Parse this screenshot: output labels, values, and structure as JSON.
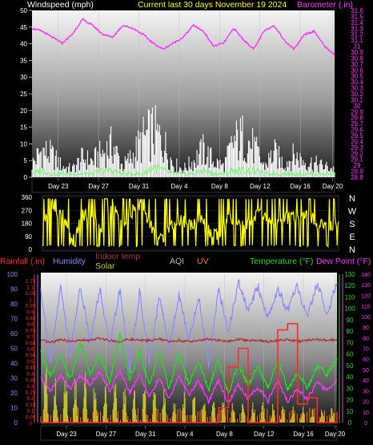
{
  "colors": {
    "wind": "#ffffff",
    "gust": "#66ff66",
    "baro": "#ff33ff",
    "dir": "#ffff00",
    "rain": "#ff2a2a",
    "humidity": "#8a8cff",
    "indoor": "#b0313d",
    "solar": "#cfcf2f",
    "aqi": "#bbbbbb",
    "uv": "#ff7a1a",
    "temp": "#22dd22",
    "dew": "#ff33ff",
    "frame": "#111111"
  },
  "header": {
    "windspeed_label": "Windspeed (mph)",
    "center_title": "Current last 30 days November 19 2024",
    "barometer_label": "Barometer (.in)"
  },
  "direction_labels": [
    "N",
    "W",
    "S",
    "E",
    "N"
  ],
  "bottom_header": {
    "rainfall": "Rainfall (.in)",
    "humidity": "Humidity",
    "indoor_temp": "Indoor temp",
    "solar": "Solar",
    "aqi": "AQI",
    "uv": "UV",
    "temperature": "Temperature (°F)",
    "dew_point": "Dew Point (°F)"
  },
  "chart_data": [
    {
      "type": "line",
      "name": "wind-barometer",
      "x_ticks": [
        "Day 23",
        "Day 27",
        "Day 31",
        "Day 4",
        "Day 8",
        "Day 12",
        "Day 16",
        "Day 20"
      ],
      "left_axis": {
        "label": "Windspeed (mph)",
        "range": [
          0,
          50
        ],
        "ticks": [
          "0",
          "5",
          "10",
          "15",
          "20",
          "25",
          "30",
          "35",
          "40",
          "45",
          "50"
        ]
      },
      "right_axis": {
        "label": "Barometer (.in)",
        "range": [
          28.8,
          31.6
        ],
        "ticks": [
          "28.8",
          "28.9",
          "29",
          "29.1",
          "29.2",
          "29.3",
          "29.4",
          "29.5",
          "29.6",
          "29.7",
          "29.8",
          "29.9",
          "30",
          "30.1",
          "30.2",
          "30.3",
          "30.4",
          "30.5",
          "30.6",
          "30.7",
          "30.8",
          "30.9",
          "31",
          "31.1",
          "31.2",
          "31.3",
          "31.4",
          "31.5",
          "31.6"
        ]
      },
      "series": [
        {
          "name": "Barometer",
          "axis": "right",
          "x": [
            0,
            1,
            2,
            3,
            4,
            5,
            6,
            7,
            8,
            9,
            10,
            11,
            12,
            13,
            14,
            15,
            16,
            17,
            18,
            19,
            20,
            21,
            22,
            23,
            24,
            25,
            26,
            27,
            28,
            29,
            30
          ],
          "values": [
            31.3,
            31.25,
            31.15,
            31.05,
            31.2,
            31.45,
            31.35,
            31.2,
            31.15,
            31.35,
            31.3,
            31.2,
            31.05,
            30.95,
            31.05,
            31.15,
            31.35,
            31.25,
            31.0,
            31.05,
            31.3,
            31.1,
            30.95,
            31.25,
            31.35,
            31.1,
            30.95,
            31.2,
            31.25,
            31.0,
            30.85
          ]
        },
        {
          "name": "Windspeed",
          "axis": "left",
          "x": [
            0,
            1,
            2,
            3,
            4,
            5,
            6,
            7,
            8,
            9,
            10,
            11,
            12,
            13,
            14,
            15,
            16,
            17,
            18,
            19,
            20,
            21,
            22,
            23,
            24,
            25,
            26,
            27,
            28,
            29,
            30
          ],
          "values": [
            5,
            10,
            8,
            4,
            3,
            7,
            6,
            9,
            12,
            4,
            8,
            14,
            17,
            13,
            5,
            3,
            6,
            10,
            6,
            4,
            13,
            15,
            11,
            4,
            9,
            5,
            8,
            6,
            5,
            4,
            3
          ]
        },
        {
          "name": "Gust",
          "axis": "left",
          "x": [
            0,
            1,
            2,
            3,
            4,
            5,
            6,
            7,
            8,
            9,
            10,
            11,
            12,
            13,
            14,
            15,
            16,
            17,
            18,
            19,
            20,
            21,
            22,
            23,
            24,
            25,
            26,
            27,
            28,
            29,
            30
          ],
          "values": [
            1,
            2,
            1,
            1,
            1,
            1,
            1,
            2,
            2,
            1,
            1,
            1,
            3,
            2,
            1,
            1,
            1,
            2,
            1,
            1,
            2,
            2,
            2,
            1,
            1,
            1,
            1,
            1,
            1,
            1,
            1
          ]
        }
      ]
    },
    {
      "type": "line",
      "name": "wind-direction",
      "axis": {
        "range": [
          0,
          360
        ],
        "ticks": [
          "0",
          "90",
          "180",
          "270",
          "360"
        ]
      },
      "series": [
        {
          "name": "Direction",
          "x": [
            0,
            1,
            2,
            3,
            4,
            5,
            6,
            7,
            8,
            9,
            10,
            11,
            12,
            13,
            14,
            15,
            16,
            17,
            18,
            19,
            20,
            21,
            22,
            23,
            24,
            25,
            26,
            27,
            28,
            29,
            30
          ],
          "values": [
            200,
            300,
            250,
            40,
            230,
            260,
            120,
            300,
            180,
            250,
            320,
            160,
            60,
            170,
            210,
            170,
            220,
            110,
            90,
            230,
            150,
            190,
            260,
            180,
            170,
            230,
            200,
            240,
            160,
            170,
            190
          ]
        }
      ]
    },
    {
      "type": "line",
      "name": "temperature-humidity-rain",
      "x_ticks": [
        "Day 23",
        "Day 27",
        "Day 31",
        "Day 4",
        "Day 8",
        "Day 12",
        "Day 16",
        "Day 20"
      ],
      "left_axes": [
        {
          "label": "Rainfall (.in)",
          "range": [
            0,
            1.2
          ],
          "ticks": [
            "0",
            "0.05",
            "0.1",
            "0.15",
            "0.2",
            "0.25",
            "0.3",
            "0.35",
            "0.4",
            "0.45",
            "0.5",
            "0.55",
            "0.6",
            "0.65",
            "0.7",
            "0.75",
            "0.8",
            "0.85",
            "0.9",
            "0.95",
            "1",
            "1.05",
            "1.1",
            "1.15"
          ]
        },
        {
          "label": "Humidity",
          "range": [
            0,
            100
          ],
          "ticks": [
            "0",
            "10",
            "20",
            "30",
            "40",
            "50",
            "60",
            "70",
            "80",
            "90",
            "100"
          ]
        }
      ],
      "right_axes": [
        {
          "label": "Temperature (°F)",
          "range": [
            0,
            130
          ],
          "ticks": [
            "0",
            "10",
            "20",
            "30",
            "40",
            "50",
            "60",
            "70",
            "80",
            "90",
            "100",
            "110",
            "120",
            "130"
          ]
        },
        {
          "label": "Dew Point (°F)",
          "range": [
            0,
            140
          ],
          "ticks": [
            "0",
            "10",
            "20",
            "30",
            "40",
            "50",
            "60",
            "70",
            "80",
            "90",
            "100",
            "110",
            "120",
            "130",
            "140"
          ]
        }
      ],
      "series": [
        {
          "name": "Humidity",
          "x": [
            0,
            1,
            2,
            3,
            4,
            5,
            6,
            7,
            8,
            9,
            10,
            11,
            12,
            13,
            14,
            15,
            16,
            17,
            18,
            19,
            20,
            21,
            22,
            23,
            24,
            25,
            26,
            27,
            28,
            29,
            30
          ],
          "values": [
            90,
            40,
            92,
            45,
            93,
            55,
            90,
            50,
            90,
            35,
            88,
            40,
            85,
            50,
            86,
            55,
            85,
            40,
            90,
            60,
            95,
            75,
            92,
            70,
            90,
            75,
            92,
            70,
            95,
            72,
            95
          ]
        },
        {
          "name": "Indoor temp",
          "x": [
            0,
            1,
            2,
            3,
            4,
            5,
            6,
            7,
            8,
            9,
            10,
            11,
            12,
            13,
            14,
            15,
            16,
            17,
            18,
            19,
            20,
            21,
            22,
            23,
            24,
            25,
            26,
            27,
            28,
            29,
            30
          ],
          "values": [
            72,
            70,
            73,
            71,
            72,
            72,
            74,
            72,
            71,
            73,
            72,
            72,
            73,
            71,
            72,
            71,
            72,
            73,
            72,
            71,
            73,
            72,
            72,
            71,
            72,
            73,
            71,
            72,
            73,
            72,
            73
          ]
        },
        {
          "name": "Temperature (°F)",
          "x": [
            0,
            1,
            2,
            3,
            4,
            5,
            6,
            7,
            8,
            9,
            10,
            11,
            12,
            13,
            14,
            15,
            16,
            17,
            18,
            19,
            20,
            21,
            22,
            23,
            24,
            25,
            26,
            27,
            28,
            29,
            30
          ],
          "values": [
            62,
            40,
            58,
            38,
            70,
            42,
            60,
            35,
            80,
            38,
            63,
            32,
            62,
            30,
            60,
            34,
            55,
            28,
            56,
            25,
            52,
            32,
            50,
            30,
            56,
            28,
            44,
            30,
            50,
            42,
            56
          ]
        },
        {
          "name": "Dew Point (°F)",
          "x": [
            0,
            1,
            2,
            3,
            4,
            5,
            6,
            7,
            8,
            9,
            10,
            11,
            12,
            13,
            14,
            15,
            16,
            17,
            18,
            19,
            20,
            21,
            22,
            23,
            24,
            25,
            26,
            27,
            28,
            29,
            30
          ],
          "values": [
            42,
            30,
            45,
            32,
            44,
            36,
            48,
            30,
            50,
            28,
            46,
            24,
            42,
            22,
            44,
            26,
            40,
            20,
            40,
            18,
            36,
            22,
            34,
            20,
            40,
            20,
            32,
            22,
            38,
            30,
            40
          ]
        },
        {
          "name": "Rainfall (.in)",
          "x": [
            0,
            1,
            2,
            3,
            4,
            5,
            6,
            7,
            8,
            9,
            10,
            11,
            12,
            13,
            14,
            15,
            16,
            17,
            18,
            19,
            20,
            21,
            22,
            23,
            24,
            25,
            26,
            27,
            28,
            29,
            30
          ],
          "values": [
            0,
            0,
            0,
            0,
            0,
            0,
            0,
            0,
            0,
            0,
            0,
            0,
            0,
            0,
            0,
            0,
            0,
            0,
            0.12,
            0.45,
            0.6,
            0,
            0,
            0,
            0.75,
            0.8,
            0.15,
            0.2,
            0,
            0,
            0.08
          ]
        },
        {
          "name": "Solar",
          "x": [
            0,
            1,
            2,
            3,
            4,
            5,
            6,
            7,
            8,
            9,
            10,
            11,
            12,
            13,
            14,
            15,
            16,
            17,
            18,
            19,
            20,
            21,
            22,
            23,
            24,
            25,
            26,
            27,
            28,
            29,
            30
          ],
          "values": [
            30,
            28,
            25,
            26,
            24,
            22,
            25,
            20,
            22,
            18,
            20,
            16,
            18,
            15,
            18,
            14,
            16,
            12,
            14,
            10,
            12,
            9,
            11,
            8,
            10,
            8,
            9,
            7,
            8,
            7,
            8
          ]
        }
      ]
    }
  ]
}
